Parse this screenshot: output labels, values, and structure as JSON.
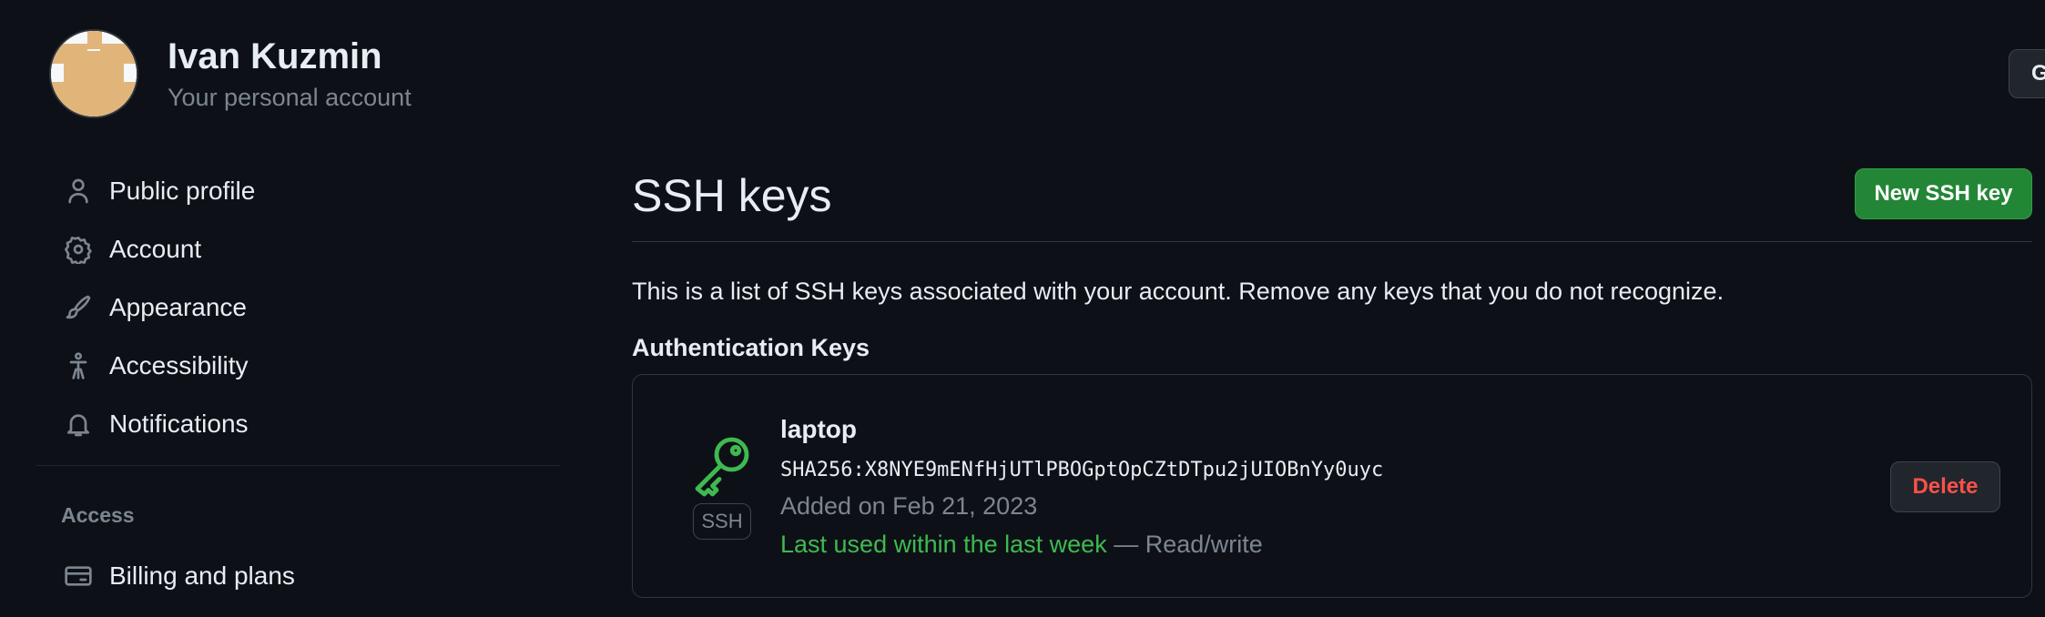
{
  "account": {
    "name": "Ivan Kuzmin",
    "subtitle": "Your personal account",
    "top_right_button": "G"
  },
  "sidebar": {
    "items": [
      {
        "label": "Public profile",
        "icon": "person-icon"
      },
      {
        "label": "Account",
        "icon": "gear-icon"
      },
      {
        "label": "Appearance",
        "icon": "paintbrush-icon"
      },
      {
        "label": "Accessibility",
        "icon": "accessibility-icon"
      },
      {
        "label": "Notifications",
        "icon": "bell-icon"
      }
    ],
    "section_access": "Access",
    "access_items": [
      {
        "label": "Billing and plans",
        "icon": "credit-card-icon"
      }
    ]
  },
  "main": {
    "title": "SSH keys",
    "new_key_button": "New SSH key",
    "intro": "This is a list of SSH keys associated with your account. Remove any keys that you do not recognize.",
    "section_heading": "Authentication Keys",
    "keys": [
      {
        "title": "laptop",
        "fingerprint": "SHA256:X8NYE9mENfHjUTlPBOGptOpCZtDTpu2jUIOBnYy0uyc",
        "added": "Added on Feb 21, 2023",
        "last_used": "Last used within the last week",
        "access": " — Read/write",
        "badge": "SSH",
        "delete_label": "Delete",
        "icon": "key-icon"
      }
    ]
  },
  "colors": {
    "background": "#0d1117",
    "accent_green": "#238636",
    "danger_red": "#f85149",
    "key_green": "#3fb950",
    "avatar_tan": "#e1b57a"
  }
}
